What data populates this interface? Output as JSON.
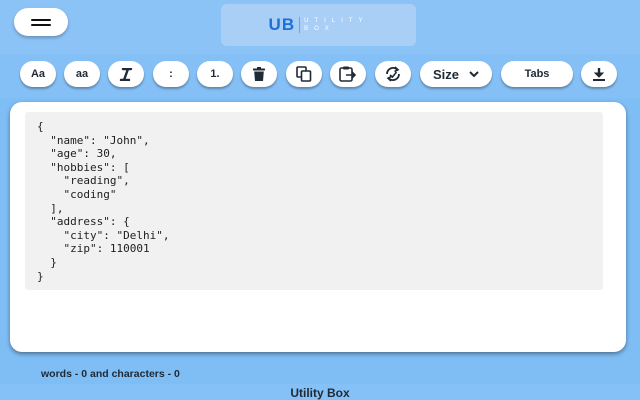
{
  "header": {
    "logo_main": "UB",
    "logo_line1": "UTILITY",
    "logo_line2": "BOX",
    "menu_icon": "hamburger-icon"
  },
  "toolbar": {
    "uppercase_label": "Aa",
    "lowercase_label": "aa",
    "italic_icon": "italic-icon",
    "colon_label": ":",
    "numbered_label": "1.",
    "clear_icon": "trash-icon",
    "copy_icon": "copy-icon",
    "paste_icon": "clipboard-icon",
    "remove_spaces_icon": "cycle-icon",
    "size_label": "Size",
    "tabs_label": "Tabs",
    "download_icon": "download-icon"
  },
  "editor": {
    "content": "{\n  \"name\": \"John\",\n  \"age\": 30,\n  \"hobbies\": [\n    \"reading\",\n    \"coding\"\n  ],\n  \"address\": {\n    \"city\": \"Delhi\",\n    \"zip\": 110001\n  }\n}"
  },
  "status": {
    "text": "words - 0 and characters - 0"
  },
  "footer": {
    "title": "Utility Box"
  },
  "colors": {
    "header_bg": "#8cc3f7",
    "accent": "#1e6fd6",
    "code_bg": "#f1f1f1"
  }
}
